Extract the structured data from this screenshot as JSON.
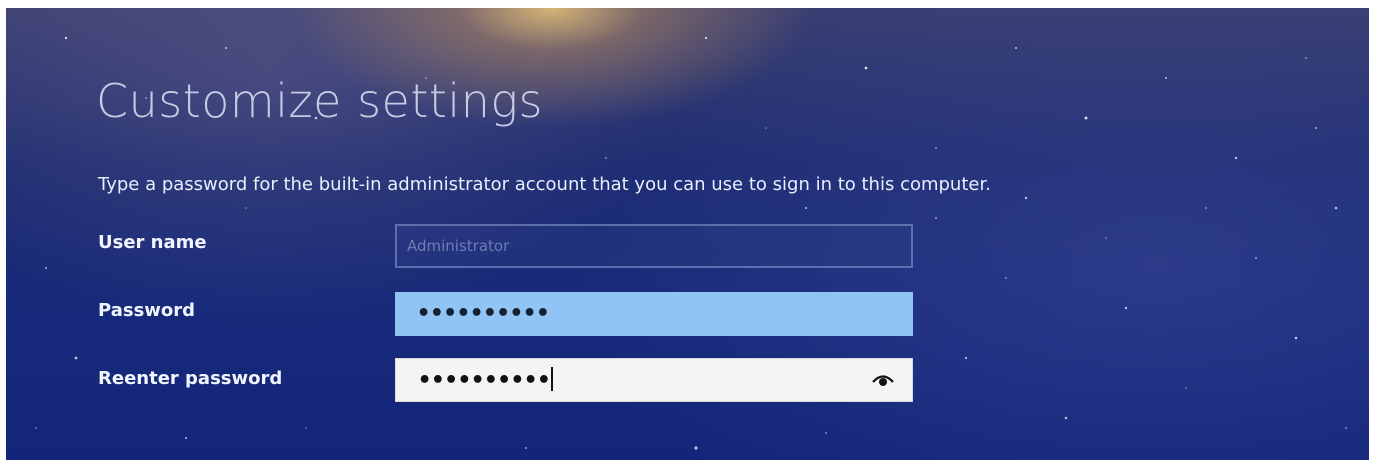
{
  "page": {
    "title": "Customize settings",
    "instructions": "Type a password for the built-in administrator account that you can use to sign in to this computer."
  },
  "fields": {
    "username": {
      "label": "User name",
      "value": "Administrator"
    },
    "password": {
      "label": "Password",
      "masked_value": "••••••••••"
    },
    "reenter_password": {
      "label": "Reenter password",
      "masked_value": "••••••••••",
      "reveal_icon": "eye-icon"
    }
  },
  "colors": {
    "background": "#16297a",
    "password_field": "#8fc4f4",
    "reenter_field": "#f4f4f2"
  }
}
